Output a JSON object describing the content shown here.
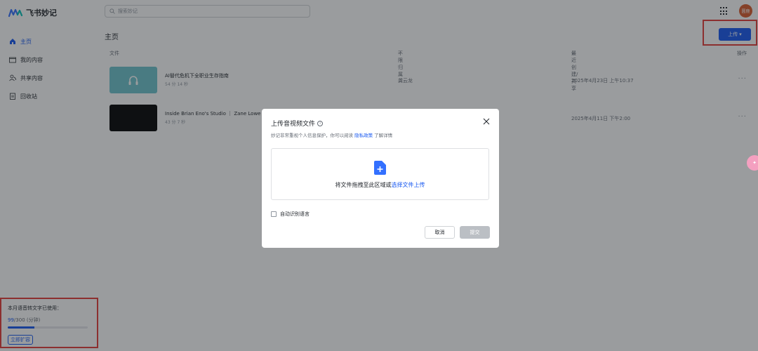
{
  "app": {
    "name": "飞书妙记",
    "logo_icon": "feishu-minutes-logo"
  },
  "sidebar": {
    "items": [
      {
        "label": "主页",
        "icon": "home-icon",
        "active": true
      },
      {
        "label": "我的内容",
        "icon": "folder-icon",
        "active": false
      },
      {
        "label": "共享内容",
        "icon": "people-icon",
        "active": false
      },
      {
        "label": "回收站",
        "icon": "trash-icon",
        "active": false
      }
    ],
    "usage": {
      "label": "本月语音转文字已使用：",
      "used": "99",
      "total": "/300 (分钟)",
      "fraction": 0.33,
      "expand_label": "立即扩容"
    }
  },
  "topbar": {
    "search_placeholder": "搜索妙记",
    "avatar_text": "圆鹿"
  },
  "page": {
    "title": "主页",
    "upload_label": "上传"
  },
  "table": {
    "headers": {
      "file": "文件",
      "owner": "不限归属",
      "date": "最近创建/共享",
      "actions": "操作"
    },
    "rows": [
      {
        "title": "AI替代危机下全职业生存指南",
        "duration": "54 分 14 秒",
        "owner": "龚云龙",
        "date": "2025年4月23日 上午10:37",
        "thumb": "audio"
      },
      {
        "title": "Inside Brian Eno's Studio ｜ Zane Lowe",
        "duration": "43 分 7 秒",
        "owner": "",
        "date": "2025年4月11日 下午2:00",
        "thumb": "video"
      }
    ]
  },
  "modal": {
    "title": "上传音视频文件",
    "subtitle_prefix": "妙记非常重视个人信息保护，你可以阅读",
    "privacy_link": "隐私政策",
    "subtitle_suffix": "了解详情",
    "drop_prefix": "将文件拖拽至此区域或",
    "drop_link": "选择文件上传",
    "auto_lang": "自动识别语言",
    "cancel": "取消",
    "submit": "提交"
  },
  "colors": {
    "accent": "#1456f0",
    "highlight": "#e53935",
    "thumb_audio": "#6cc3cc",
    "avatar": "#d9592b"
  }
}
